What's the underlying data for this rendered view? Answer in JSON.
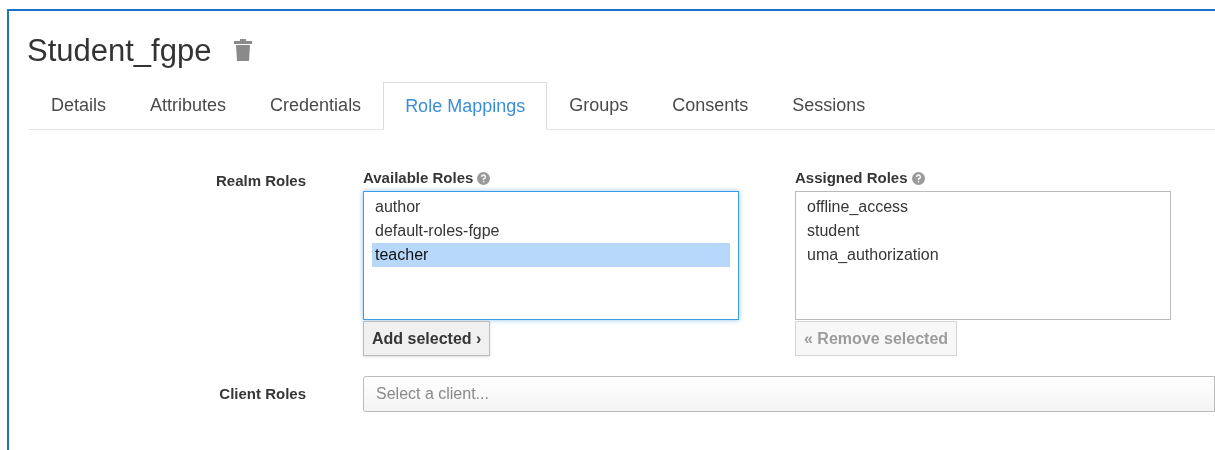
{
  "title": "Student_fgpe",
  "tabs": [
    {
      "label": "Details",
      "selected": false
    },
    {
      "label": "Attributes",
      "selected": false
    },
    {
      "label": "Credentials",
      "selected": false
    },
    {
      "label": "Role Mappings",
      "selected": true
    },
    {
      "label": "Groups",
      "selected": false
    },
    {
      "label": "Consents",
      "selected": false
    },
    {
      "label": "Sessions",
      "selected": false
    }
  ],
  "realm_roles": {
    "label": "Realm Roles",
    "available": {
      "label": "Available Roles",
      "focused": true,
      "items": [
        {
          "label": "author",
          "selected": false
        },
        {
          "label": "default-roles-fgpe",
          "selected": false
        },
        {
          "label": "teacher",
          "selected": true
        }
      ],
      "button": {
        "label": "Add selected ›",
        "disabled": false
      }
    },
    "assigned": {
      "label": "Assigned Roles",
      "focused": false,
      "items": [
        {
          "label": "offline_access",
          "selected": false
        },
        {
          "label": "student",
          "selected": false
        },
        {
          "label": "uma_authorization",
          "selected": false
        }
      ],
      "button": {
        "label": "« Remove selected",
        "disabled": true
      }
    }
  },
  "client_roles": {
    "label": "Client Roles",
    "placeholder": "Select a client..."
  }
}
